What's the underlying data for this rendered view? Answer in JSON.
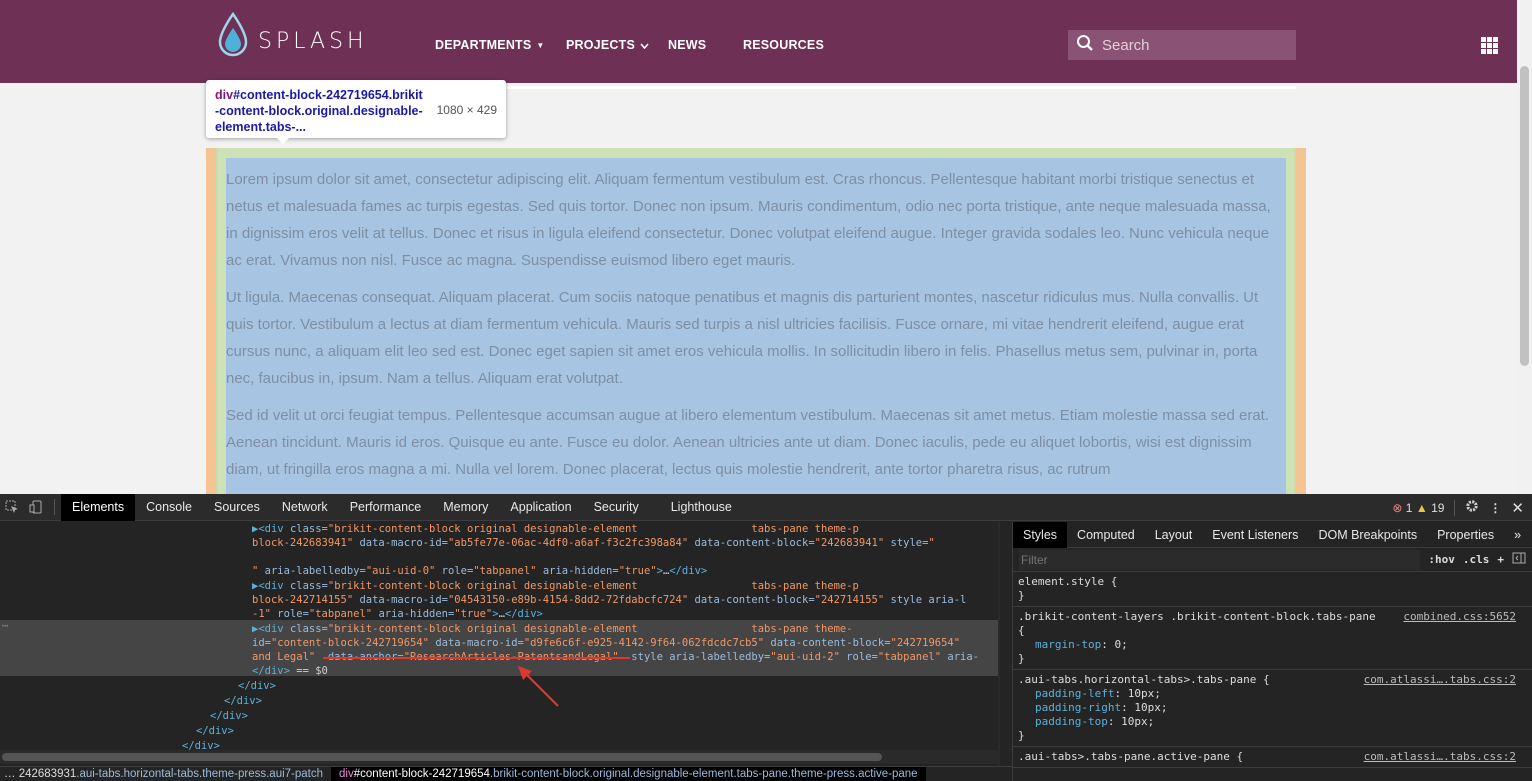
{
  "site": {
    "logo_text": "SPLASH",
    "nav": [
      "DEPARTMENTS",
      "PROJECTS",
      "NEWS",
      "RESOURCES"
    ],
    "search_placeholder": "Search",
    "paragraphs": [
      "Lorem ipsum dolor sit amet, consectetur adipiscing elit. Aliquam fermentum vestibulum est. Cras rhoncus. Pellentesque habitant morbi tristique senectus et netus et malesuada fames ac turpis egestas. Sed quis tortor. Donec non ipsum. Mauris condimentum, odio nec porta tristique, ante neque malesuada massa, in dignissim eros velit at tellus. Donec et risus in ligula eleifend consectetur. Donec volutpat eleifend augue. Integer gravida sodales leo. Nunc vehicula neque ac erat. Vivamus non nisl. Fusce ac magna. Suspendisse euismod libero eget mauris.",
      "Ut ligula. Maecenas consequat. Aliquam placerat. Cum sociis natoque penatibus et magnis dis parturient montes, nascetur ridiculus mus. Nulla convallis. Ut quis tortor. Vestibulum a lectus at diam fermentum vehicula. Mauris sed turpis a nisl ultricies facilisis. Fusce ornare, mi vitae hendrerit eleifend, augue erat cursus nunc, a aliquam elit leo sed est. Donec eget sapien sit amet eros vehicula mollis. In sollicitudin libero in felis. Phasellus metus sem, pulvinar in, porta nec, faucibus in, ipsum. Nam a tellus. Aliquam erat volutpat.",
      "Sed id velit ut orci feugiat tempus. Pellentesque accumsan augue at libero elementum vestibulum. Maecenas sit amet metus. Etiam molestie massa sed erat. Aenean tincidunt. Mauris id eros. Quisque eu ante. Fusce eu dolor. Aenean ultricies ante ut diam. Donec iaculis, pede eu aliquet lobortis, wisi est dignissim diam, ut fringilla eros magna a mi. Nulla vel lorem. Donec placerat, lectus quis molestie hendrerit, ante tortor pharetra risus, ac rutrum"
    ]
  },
  "tooltip": {
    "tag": "div",
    "selector": "#content-block-242719654.brikit-content-block.original.designable-element.tabs-...",
    "dimensions": "1080 × 429"
  },
  "devtools": {
    "tabs": [
      "Elements",
      "Console",
      "Sources",
      "Network",
      "Performance",
      "Memory",
      "Application",
      "Security",
      "Lighthouse"
    ],
    "error_count": "1",
    "warning_count": "19",
    "code_lines": [
      {
        "indent": "",
        "parts": [
          [
            "tg",
            "▶<div "
          ],
          [
            "at",
            "class="
          ],
          [
            "av",
            "\"brikit-content-block original designable-element                  tabs-pane theme-p"
          ]
        ]
      },
      {
        "indent": "",
        "parts": [
          [
            "av",
            "block-242683941\" "
          ],
          [
            "at",
            "data-macro-id="
          ],
          [
            "av",
            "\"ab5fe77e-06ac-4df0-a6af-f3c2fc398a84\" "
          ],
          [
            "at",
            "data-content-block="
          ],
          [
            "av",
            "\"242683941\" "
          ],
          [
            "at",
            "style="
          ],
          [
            "av",
            "\""
          ]
        ]
      },
      {
        "indent": "",
        "parts": []
      },
      {
        "indent": "",
        "parts": [
          [
            "av",
            "\" "
          ],
          [
            "at",
            "aria-labelledby="
          ],
          [
            "av",
            "\"aui-uid-0\" "
          ],
          [
            "at",
            "role="
          ],
          [
            "av",
            "\"tabpanel\" "
          ],
          [
            "at",
            "aria-hidden="
          ],
          [
            "av",
            "\"true\""
          ],
          [
            "tg",
            ">"
          ],
          [
            "tx",
            "…"
          ],
          [
            "tg",
            "</div>"
          ]
        ]
      },
      {
        "indent": "",
        "parts": [
          [
            "tg",
            "▶<div "
          ],
          [
            "at",
            "class="
          ],
          [
            "av",
            "\"brikit-content-block original designable-element                  tabs-pane theme-p"
          ]
        ]
      },
      {
        "indent": "",
        "parts": [
          [
            "av",
            "block-242714155\" "
          ],
          [
            "at",
            "data-macro-id="
          ],
          [
            "av",
            "\"04543150-e89b-4154-8dd2-72fdabcfc724\" "
          ],
          [
            "at",
            "data-content-block="
          ],
          [
            "av",
            "\"242714155\" "
          ],
          [
            "at",
            "style aria-l"
          ]
        ]
      },
      {
        "indent": "",
        "parts": [
          [
            "av",
            "-1\" "
          ],
          [
            "at",
            "role="
          ],
          [
            "av",
            "\"tabpanel\" "
          ],
          [
            "at",
            "aria-hidden="
          ],
          [
            "av",
            "\"true\""
          ],
          [
            "tg",
            ">"
          ],
          [
            "tx",
            "…"
          ],
          [
            "tg",
            "</div>"
          ]
        ]
      },
      {
        "indent": "",
        "parts": [
          [
            "tg",
            "▶<div "
          ],
          [
            "at",
            "class="
          ],
          [
            "av",
            "\"brikit-content-block original designable-element                  tabs-pane theme-"
          ]
        ]
      },
      {
        "indent": "",
        "parts": [
          [
            "at",
            "id="
          ],
          [
            "av",
            "\"content-block-242719654\" "
          ],
          [
            "at",
            "data-macro-id="
          ],
          [
            "av",
            "\"d9fe6c6f-e925-4142-9f64-062fdcdc7cb5\" "
          ],
          [
            "at",
            "data-content-block="
          ],
          [
            "av",
            "\"242719654\""
          ]
        ]
      },
      {
        "indent": "",
        "parts": [
          [
            "av",
            "and Legal\"  "
          ],
          [
            "at",
            "data-anchor="
          ],
          [
            "av",
            "\"ResearchArticles-PatentsandLegal\"  "
          ],
          [
            "at",
            "style aria-labelledby="
          ],
          [
            "av",
            "\"aui-uid-2\" "
          ],
          [
            "at",
            "role="
          ],
          [
            "av",
            "\"tabpanel\" "
          ],
          [
            "at",
            "aria-"
          ]
        ]
      },
      {
        "indent": "",
        "parts": [
          [
            "tg",
            "</div>"
          ],
          [
            "tx",
            " == "
          ],
          [
            "tx",
            "$0"
          ]
        ]
      },
      {
        "indent": "",
        "parts": [
          [
            "tg",
            "</div>"
          ]
        ]
      },
      {
        "indent": "",
        "parts": [
          [
            "tg",
            "</div>"
          ]
        ]
      },
      {
        "indent": "",
        "parts": [
          [
            "tg",
            "</div>"
          ]
        ]
      },
      {
        "indent": "",
        "parts": [
          [
            "tg",
            "</div>"
          ]
        ]
      },
      {
        "indent": "",
        "parts": [
          [
            "tg",
            "</div>"
          ]
        ]
      }
    ],
    "breadcrumb": {
      "first_id": "242683931",
      "first_cls": ".aui-tabs.horizontal-tabs.theme-press.aui7-patch",
      "second_tag": "div",
      "second_id": "#content-block-242719654",
      "second_cls": ".brikit-content-block.original.designable-element.tabs-pane.theme-press.active-pane"
    },
    "styles": {
      "tabs": [
        "Styles",
        "Computed",
        "Layout",
        "Event Listeners",
        "DOM Breakpoints",
        "Properties"
      ],
      "filter_placeholder": "Filter",
      "hov": ":hov",
      "cls": ".cls",
      "rules": [
        {
          "selector": "element.style {",
          "source": "",
          "props": [],
          "close": "}"
        },
        {
          "selector": ".brikit-content-layers .brikit-content-block.tabs-pane",
          "source": "combined.css:5652",
          "open": "{",
          "props": [
            [
              "margin-top",
              "0;"
            ]
          ],
          "close": "}"
        },
        {
          "selector": ".aui-tabs.horizontal-tabs>.tabs-pane {",
          "source": "com.atlassi….tabs.css:2",
          "props": [
            [
              "padding-left",
              "10px;"
            ],
            [
              "padding-right",
              "10px;"
            ],
            [
              "padding-top",
              "10px;"
            ]
          ],
          "close": "}"
        },
        {
          "selector": ".aui-tabs>.tabs-pane.active-pane {",
          "source": "com.atlassi….tabs.css:2",
          "props": [],
          "close": ""
        }
      ]
    }
  }
}
